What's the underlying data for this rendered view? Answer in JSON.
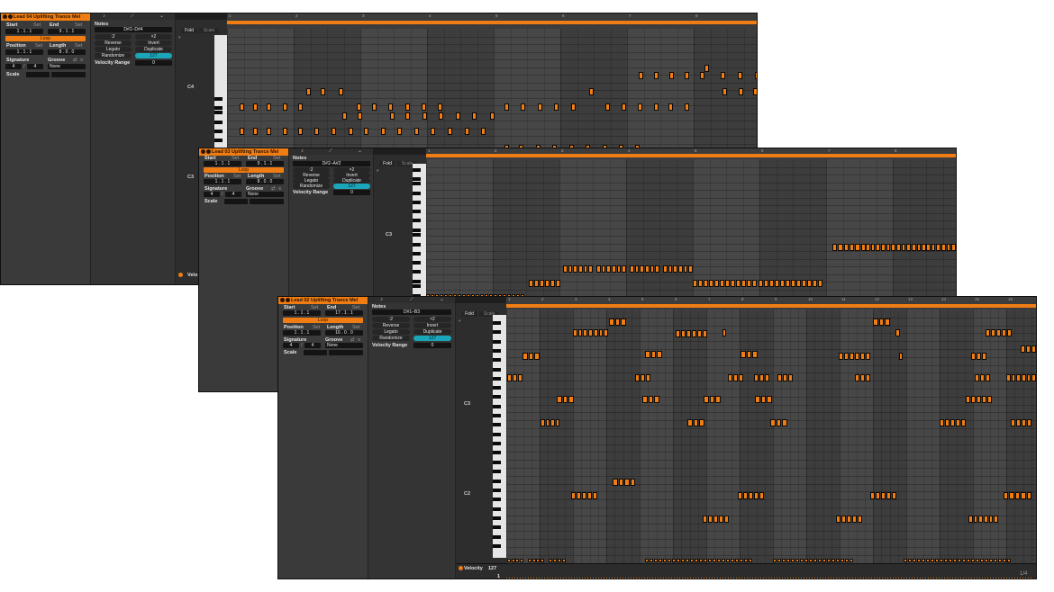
{
  "windows": [
    {
      "title": "Lead 04 Uplifting Trance Mel",
      "start_label": "Start",
      "end_label": "End",
      "set_label": "Set",
      "start_value": "1 .  1 .  1",
      "end_value": "9 .  1 .  1",
      "loop_label": "Loop",
      "position_label": "Position",
      "length_label": "Length",
      "position_value": "1 .  1 .  1",
      "length_value": "8 .  0 .  0",
      "signature_label": "Signature",
      "groove_label": "Groove",
      "sig_num": "4",
      "sig_den": "4",
      "groove_value": "None",
      "scale_label": "Scale",
      "notes_label": "Notes",
      "notes_range": "D#2–D#4",
      "btn_half": ":2",
      "btn_double": "×2",
      "btn_reverse": "Reverse",
      "btn_invert": "Invert",
      "btn_legato": "Legato",
      "btn_duplicate": "Duplicate",
      "randomize_label": "Randomize",
      "randomize_value": "127",
      "velocity_range_label": "Velocity Range",
      "velocity_range_value": "0",
      "fold_label": "Fold",
      "scale_btn_label": "Scale",
      "octave_labels": [
        "C4",
        "C3"
      ],
      "ruler_numbers": [
        "1",
        "2",
        "3",
        "4",
        "5",
        "6",
        "7",
        "8",
        "9"
      ],
      "velocity_label": "Velo"
    },
    {
      "title": "Lead 03 Uplifting Trance Mel",
      "start_label": "Start",
      "end_label": "End",
      "set_label": "Set",
      "start_value": "1 .  1 .  1",
      "end_value": "9 .  1 .  1",
      "loop_label": "Loop",
      "position_label": "Position",
      "length_label": "Length",
      "position_value": "1 .  1 .  1",
      "length_value": "8 .  0 .  0",
      "signature_label": "Signature",
      "groove_label": "Groove",
      "sig_num": "4",
      "sig_den": "4",
      "groove_value": "None",
      "scale_label": "Scale",
      "notes_label": "Notes",
      "notes_range": "D#2–A#2",
      "btn_half": ":2",
      "btn_double": "×2",
      "btn_reverse": "Reverse",
      "btn_invert": "Invert",
      "btn_legato": "Legato",
      "btn_duplicate": "Duplicate",
      "randomize_label": "Randomize",
      "randomize_value": "127",
      "velocity_range_label": "Velocity Range",
      "velocity_range_value": "0",
      "fold_label": "Fold",
      "scale_btn_label": "Scale",
      "octave_labels": [
        "C3"
      ],
      "ruler_numbers": [
        "1",
        "2",
        "3",
        "4",
        "5",
        "6",
        "7",
        "8",
        "9"
      ]
    },
    {
      "title": "Lead 02 Uplifting Trance Mel",
      "start_label": "Start",
      "end_label": "End",
      "set_label": "Set",
      "start_value": "1 .  1 .  1",
      "end_value": "17 .  1 .  1",
      "loop_label": "Loop",
      "position_label": "Position",
      "length_label": "Length",
      "position_value": "1 .  1 .  1",
      "length_value": "16 .  0 .  0",
      "signature_label": "Signature",
      "groove_label": "Groove",
      "sig_num": "4",
      "sig_den": "4",
      "groove_value": "None",
      "scale_label": "Scale",
      "notes_label": "Notes",
      "notes_range": "D#1–B3",
      "btn_half": ":2",
      "btn_double": "×2",
      "btn_reverse": "Reverse",
      "btn_invert": "Invert",
      "btn_legato": "Legato",
      "btn_duplicate": "Duplicate",
      "randomize_label": "Randomize",
      "randomize_value": "127",
      "velocity_range_label": "Velocity Range",
      "velocity_range_value": "0",
      "fold_label": "Fold",
      "scale_btn_label": "Scale",
      "octave_labels": [
        "C3",
        "C2"
      ],
      "ruler_numbers": [
        "1",
        "2",
        "3",
        "4",
        "5",
        "6",
        "7",
        "8",
        "9",
        "10",
        "11",
        "12",
        "13",
        "14",
        "15",
        "16"
      ],
      "velocity_label": "Velocity",
      "velocity_value": "127",
      "velocity_min": "1",
      "grid_fraction": "1/4"
    }
  ],
  "colors": {
    "accent": "#ef7d13",
    "teal": "#1aa6b8",
    "panel": "#3a3a3a",
    "background": "#1e1e1e"
  }
}
